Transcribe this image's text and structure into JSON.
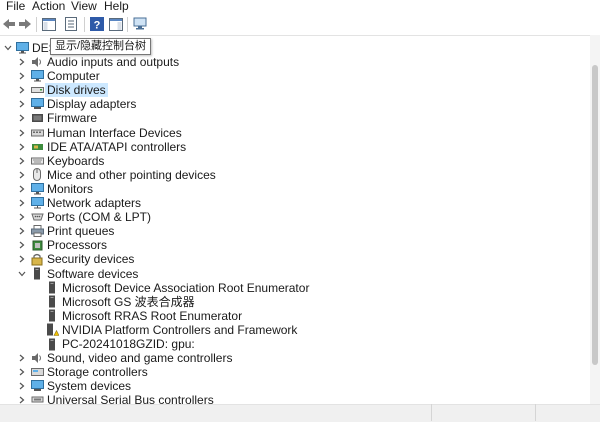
{
  "menu": [
    "File",
    "Action",
    "View",
    "Help"
  ],
  "toolbar": {
    "buttons": [
      "back-arrow-icon",
      "forward-arrow-icon",
      "show-hide-console-tree-icon",
      "properties-icon",
      "help-icon",
      "action-pane-icon",
      "scan-hardware-icon"
    ]
  },
  "tooltip": "显示/隐藏控制台树",
  "tree": {
    "root": "DES",
    "items": [
      {
        "label": "Audio inputs and outputs",
        "icon": "speaker-icon"
      },
      {
        "label": "Computer",
        "icon": "computer-icon"
      },
      {
        "label": "Disk drives",
        "icon": "disk-drive-icon",
        "selected": true
      },
      {
        "label": "Display adapters",
        "icon": "display-adapter-icon"
      },
      {
        "label": "Firmware",
        "icon": "firmware-icon"
      },
      {
        "label": "Human Interface Devices",
        "icon": "hid-icon"
      },
      {
        "label": "IDE ATA/ATAPI controllers",
        "icon": "ide-controller-icon"
      },
      {
        "label": "Keyboards",
        "icon": "keyboard-icon"
      },
      {
        "label": "Mice and other pointing devices",
        "icon": "mouse-icon"
      },
      {
        "label": "Monitors",
        "icon": "monitor-icon"
      },
      {
        "label": "Network adapters",
        "icon": "network-adapter-icon"
      },
      {
        "label": "Ports (COM & LPT)",
        "icon": "port-icon"
      },
      {
        "label": "Print queues",
        "icon": "printer-icon"
      },
      {
        "label": "Processors",
        "icon": "processor-icon"
      },
      {
        "label": "Security devices",
        "icon": "security-device-icon"
      },
      {
        "label": "Software devices",
        "icon": "software-device-icon",
        "expanded": true
      },
      {
        "label": "Sound, video and game controllers",
        "icon": "speaker-icon"
      },
      {
        "label": "Storage controllers",
        "icon": "storage-controller-icon"
      },
      {
        "label": "System devices",
        "icon": "system-device-icon"
      },
      {
        "label": "Universal Serial Bus controllers",
        "icon": "usb-icon"
      }
    ],
    "software_children": [
      {
        "label": "Microsoft Device Association Root Enumerator",
        "icon": "software-device-icon"
      },
      {
        "label": "Microsoft GS 波表合成器",
        "icon": "software-device-icon"
      },
      {
        "label": "Microsoft RRAS Root Enumerator",
        "icon": "software-device-icon"
      },
      {
        "label": "NVIDIA Platform Controllers and Framework",
        "icon": "warning-device-icon"
      },
      {
        "label": "PC-20241018GZID: gpu:",
        "icon": "software-device-icon"
      }
    ]
  },
  "colors": {
    "selection": "#cce8ff",
    "chevron": "#555555"
  }
}
